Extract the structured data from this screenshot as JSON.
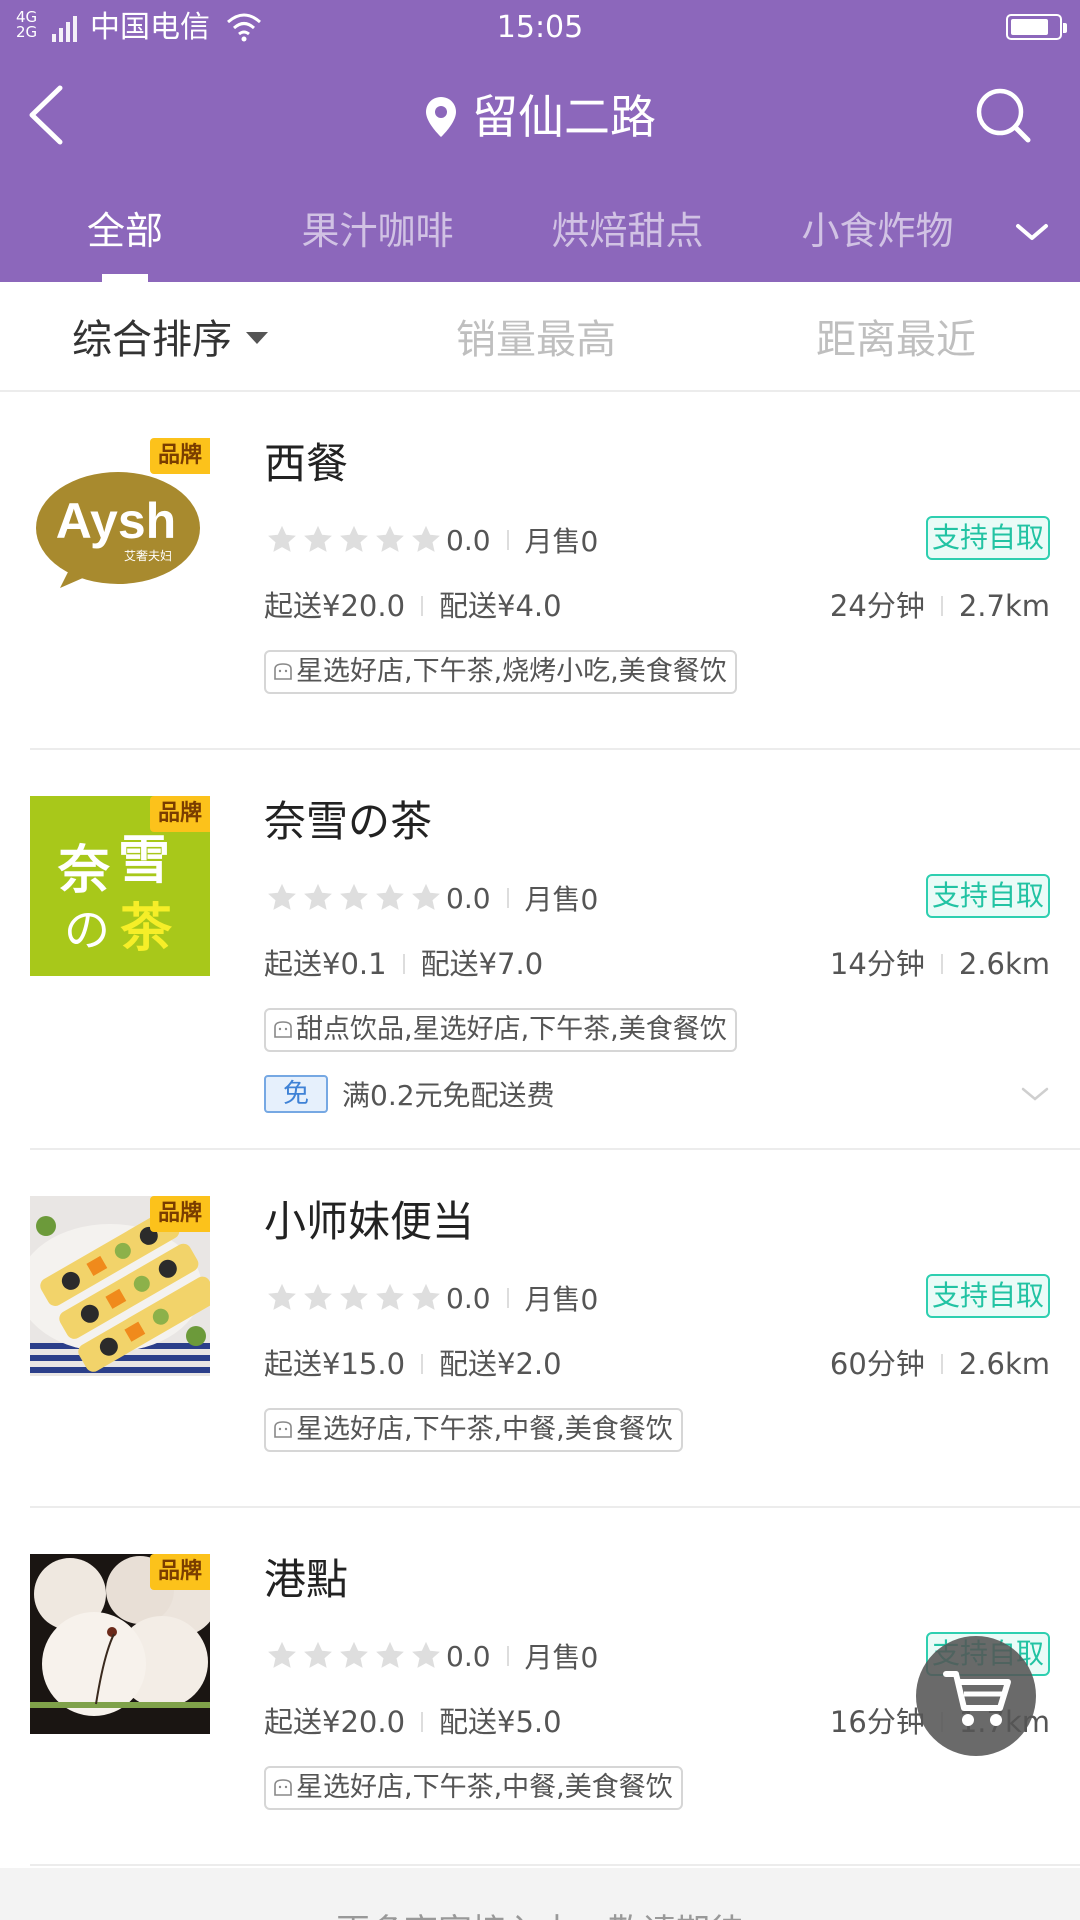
{
  "status_bar": {
    "network": "4G 2G",
    "carrier": "中国电信",
    "time": "15:05",
    "battery_level": 0.8
  },
  "header": {
    "location": "留仙二路",
    "bg_color": "#8c67bb",
    "back_icon": "back-arrow-icon",
    "search_icon": "search-icon"
  },
  "tabs": [
    {
      "label": "全部",
      "active": true
    },
    {
      "label": "果汁咖啡",
      "active": false
    },
    {
      "label": "烘焙甜点",
      "active": false
    },
    {
      "label": "小食炸物",
      "active": false
    }
  ],
  "sort": [
    {
      "label": "综合排序",
      "active": true
    },
    {
      "label": "销量最高",
      "active": false
    },
    {
      "label": "距离最近",
      "active": false
    }
  ],
  "shops": [
    {
      "name": "西餐",
      "badge": "品牌",
      "logo_text": "Aysh",
      "logo_sub": "艾奢夫妇",
      "rating": "0.0",
      "monthly_sales": "月售0",
      "pickup": "支持自取",
      "min_order": "起送¥20.0",
      "delivery_fee": "配送¥4.0",
      "time": "24分钟",
      "distance": "2.7km",
      "tags": "星选好店,下午茶,烧烤小吃,美食餐饮"
    },
    {
      "name": "奈雪の茶",
      "badge": "品牌",
      "logo_text": "奈雪の茶",
      "rating": "0.0",
      "monthly_sales": "月售0",
      "pickup": "支持自取",
      "min_order": "起送¥0.1",
      "delivery_fee": "配送¥7.0",
      "time": "14分钟",
      "distance": "2.6km",
      "tags": "甜点饮品,星选好店,下午茶,美食餐饮",
      "promo_badge": "免",
      "promo_text": "满0.2元免配送费"
    },
    {
      "name": "小师妹便当",
      "badge": "品牌",
      "rating": "0.0",
      "monthly_sales": "月售0",
      "pickup": "支持自取",
      "min_order": "起送¥15.0",
      "delivery_fee": "配送¥2.0",
      "time": "60分钟",
      "distance": "2.6km",
      "tags": "星选好店,下午茶,中餐,美食餐饮"
    },
    {
      "name": "港點",
      "badge": "品牌",
      "rating": "0.0",
      "monthly_sales": "月售0",
      "pickup": "支持自取",
      "min_order": "起送¥20.0",
      "delivery_fee": "配送¥5.0",
      "time": "16分钟",
      "distance": "1.7km",
      "tags": "星选好店,下午茶,中餐,美食餐饮"
    }
  ],
  "footer": {
    "text": "更多商家接入中，敬请期待"
  },
  "cart_icon": "shopping-cart-icon"
}
